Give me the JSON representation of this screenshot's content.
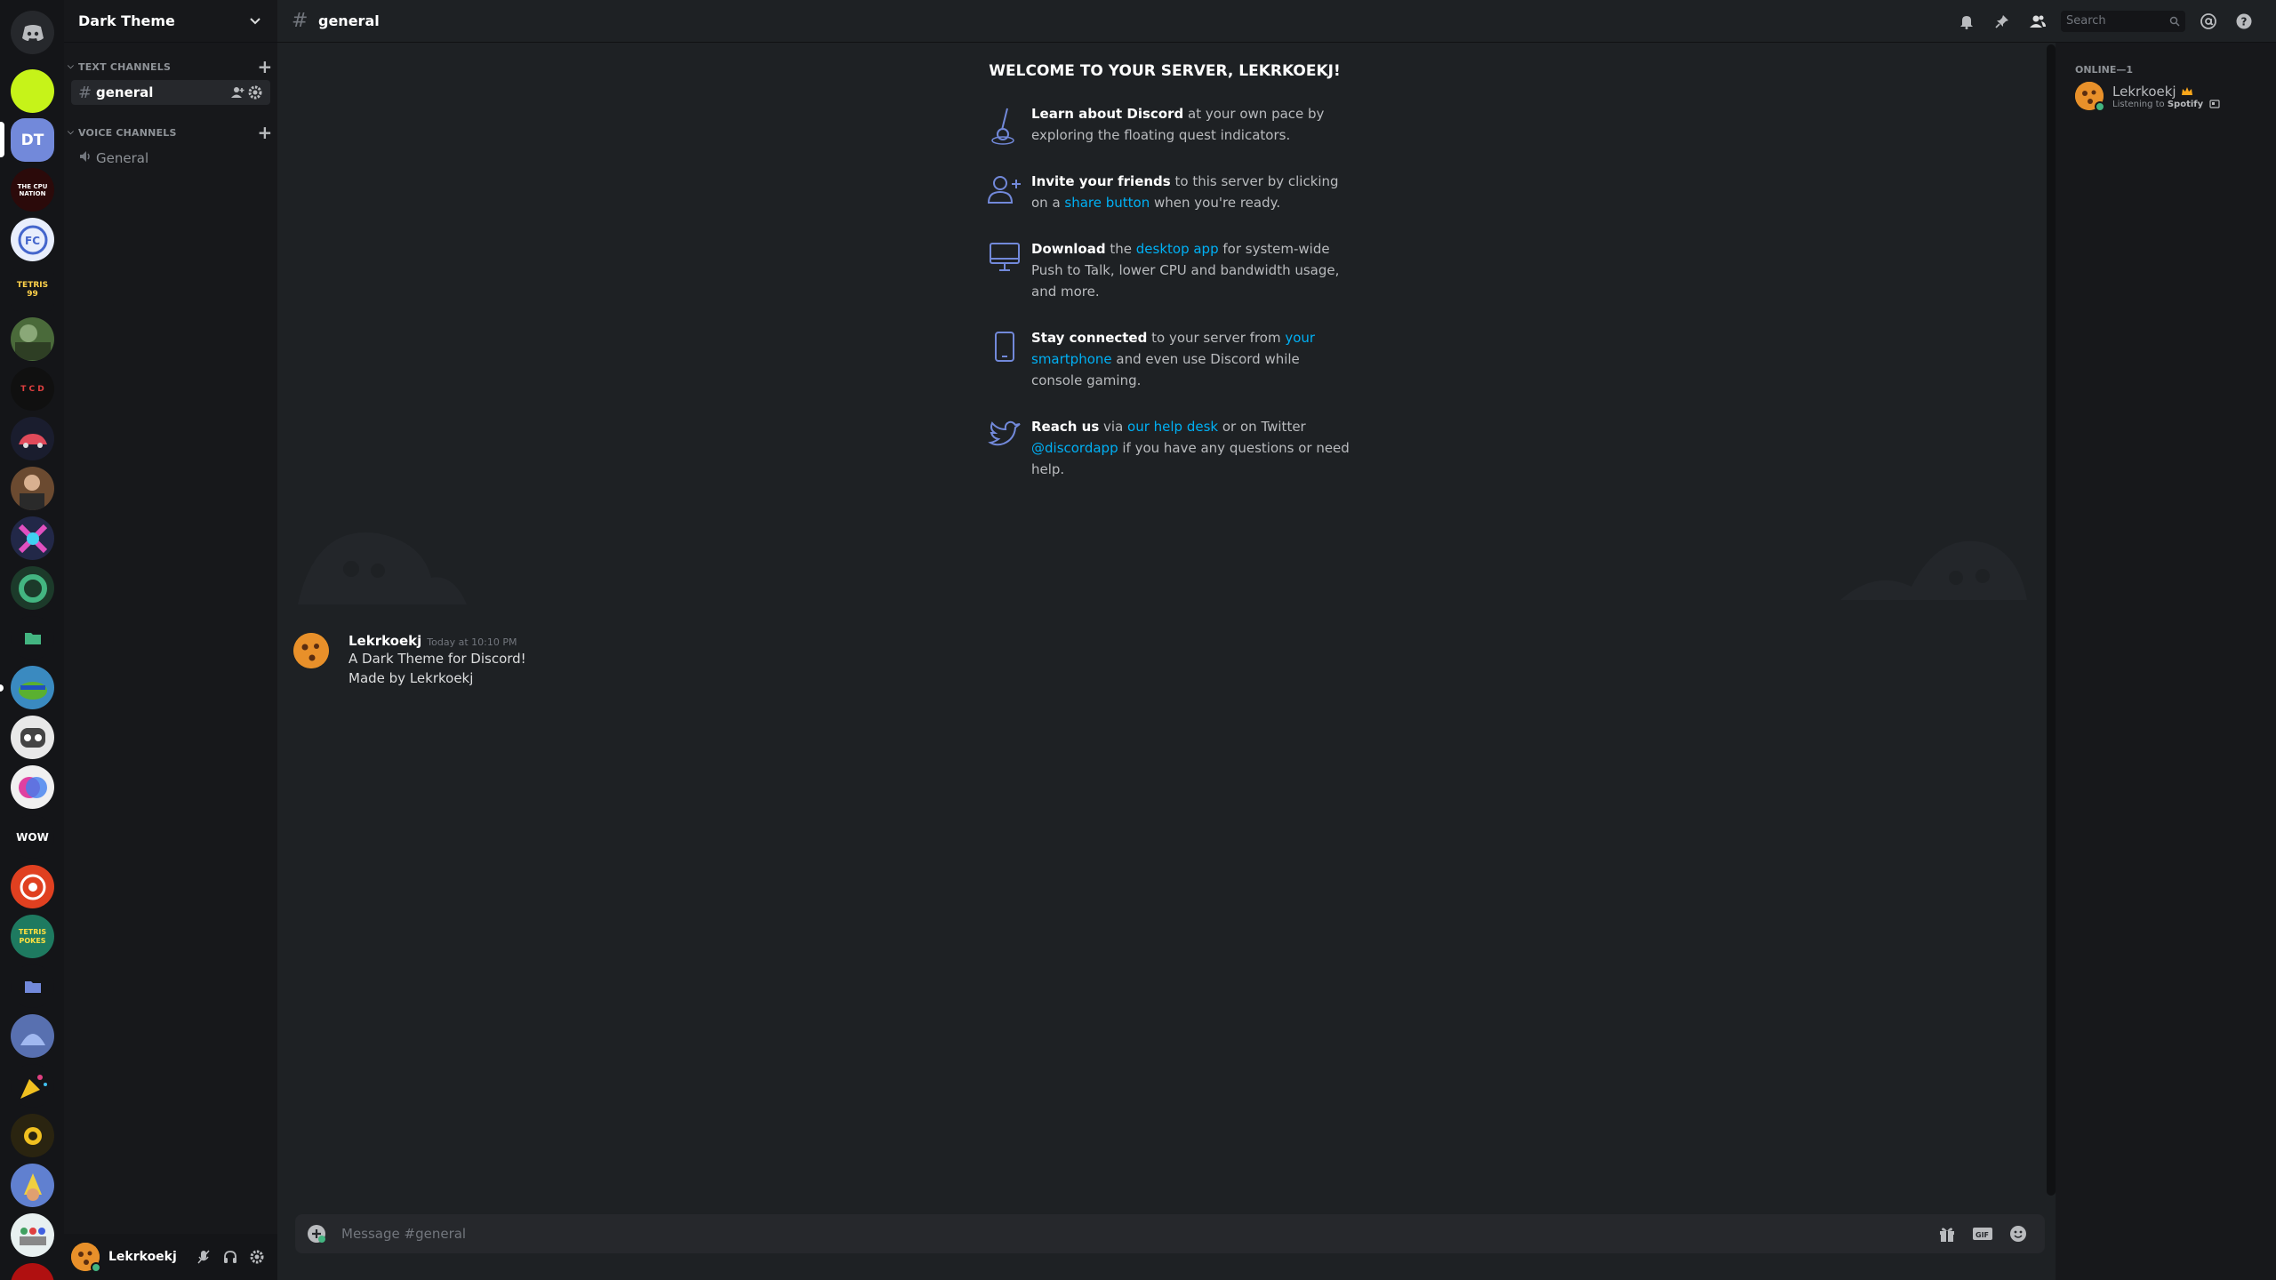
{
  "server": {
    "name": "Dark Theme"
  },
  "guilds": {
    "home_label": "Home",
    "selected_abbr": "DT",
    "wow_label": "WOW",
    "cpu_label": "THE CPU NATION",
    "tetris_label": "TETRIS 99",
    "tcd_label": "T C D",
    "tetrismons_label": "TETRIS POKES"
  },
  "sidebar": {
    "categories": [
      {
        "label": "TEXT CHANNELS"
      },
      {
        "label": "VOICE CHANNELS"
      }
    ],
    "channels": [
      {
        "name": "general",
        "type": "text"
      },
      {
        "name": "General",
        "type": "voice"
      }
    ]
  },
  "user_panel": {
    "name": "Lekrkoekj"
  },
  "topbar": {
    "hash": "#",
    "channel": "general",
    "search_placeholder": "Search"
  },
  "welcome": {
    "title": "WELCOME TO YOUR SERVER, LEKRKOEKJ!",
    "tips": [
      {
        "bold": "Learn about Discord",
        "parts": [
          " at your own pace by exploring the floating quest indicators."
        ]
      },
      {
        "bold": "Invite your friends",
        "t1": " to this server by clicking on a ",
        "link": "share button",
        "t2": " when you're ready."
      },
      {
        "bold": "Download",
        "t1": " the ",
        "link": "desktop app",
        "t2": " for system-wide Push to Talk, lower CPU and bandwidth usage, and more."
      },
      {
        "bold": "Stay connected",
        "t1": " to your server from ",
        "link": "your smartphone",
        "t2": " and even use Discord while console gaming."
      },
      {
        "bold": "Reach us",
        "t1": " via ",
        "link": "our help desk",
        "t2": " or on Twitter ",
        "link2": "@discordapp",
        "t3": " if you have any questions or need help."
      }
    ]
  },
  "message": {
    "author": "Lekrkoekj",
    "time": "Today at 10:10 PM",
    "lines": [
      "A Dark Theme for Discord!",
      "Made by Lekrkoekj"
    ]
  },
  "composer": {
    "placeholder": "Message #general"
  },
  "members": {
    "header": "ONLINE—1",
    "list": [
      {
        "name": "Lekrkoekj",
        "activity_prefix": "Listening to ",
        "activity": "Spotify"
      }
    ]
  },
  "colors": {
    "accent": "#7289da",
    "link": "#00b0f4",
    "online": "#43b581",
    "background": "#1e2124"
  }
}
